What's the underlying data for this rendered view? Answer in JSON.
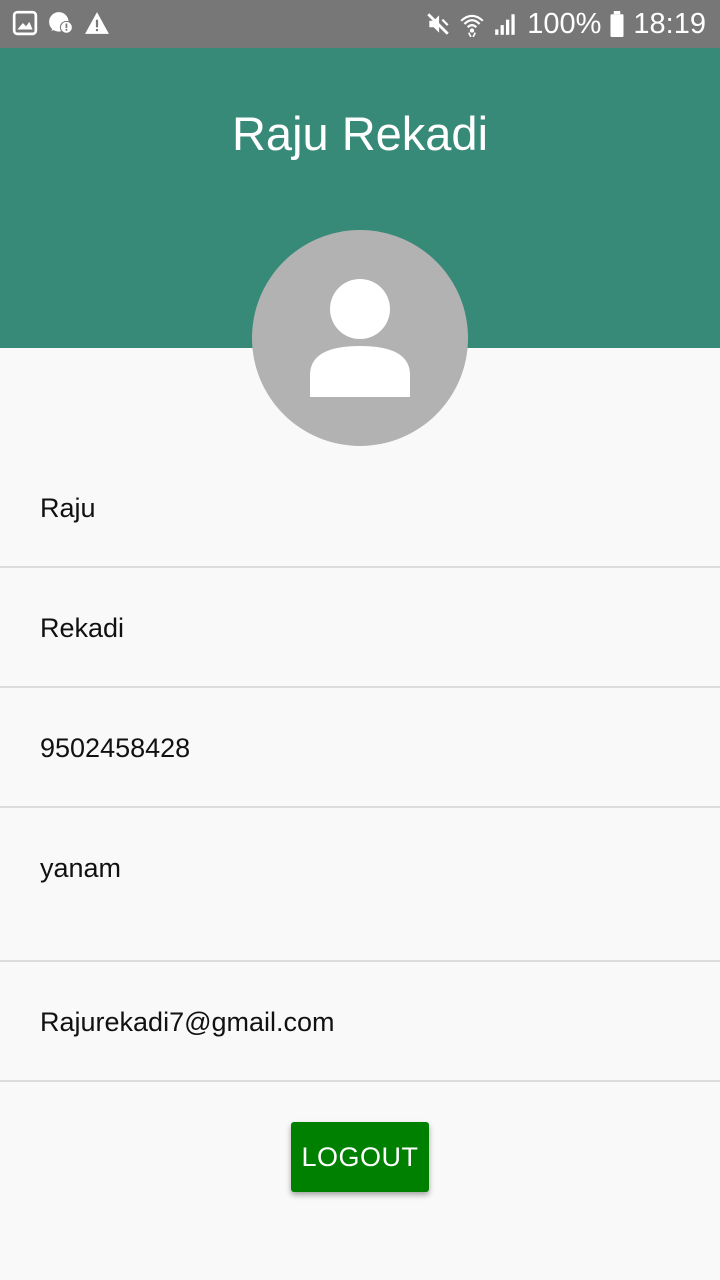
{
  "status_bar": {
    "battery_text": "100%",
    "time": "18:19",
    "left_icons": [
      "image-icon",
      "chat-alert-icon",
      "warning-icon"
    ],
    "right_icons": [
      "mute-icon",
      "wifi-icon",
      "signal-icon",
      "battery-icon"
    ]
  },
  "header": {
    "title": "Raju Rekadi",
    "background": "#388a78"
  },
  "avatar": {
    "icon": "person-icon",
    "background": "#b2b2b2"
  },
  "profile": {
    "first_name": "Raju",
    "last_name": "Rekadi",
    "phone": "9502458428",
    "city": "yanam",
    "email": "Rajurekadi7@gmail.com"
  },
  "logout_button": {
    "label": "LOGOUT",
    "color": "#008000"
  }
}
